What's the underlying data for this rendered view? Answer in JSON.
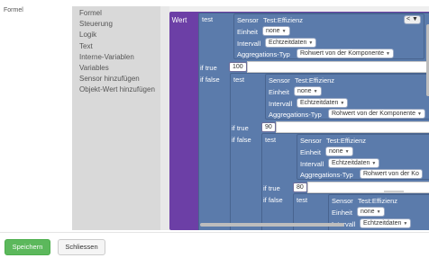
{
  "form": {
    "label": "Formel"
  },
  "palette": {
    "items": [
      "Formel",
      "Steuerung",
      "Logik",
      "Text",
      "Interne-Variablen",
      "Variables",
      "Sensor hinzufügen",
      "Objekt-Wert hinzufügen"
    ]
  },
  "blocks": {
    "wert_label": "Wert",
    "test_label": "test",
    "if_true_label": "if true",
    "if_false_label": "if false",
    "operator": "<",
    "sensor": {
      "title": "Sensor",
      "name": "Test:Effizienz",
      "einheit_label": "Einheit",
      "einheit_value": "none",
      "intervall_label": "Intervall",
      "intervall_value": "Echtzeitdaten",
      "agg_label": "Aggregations-Typ",
      "agg_value": "Rohwert von der Komponente",
      "agg_value_cut": "Rohwert von der Ko"
    },
    "values": [
      "100",
      "90",
      "80"
    ]
  },
  "footer": {
    "save": "Speichern",
    "close": "Schliessen"
  }
}
